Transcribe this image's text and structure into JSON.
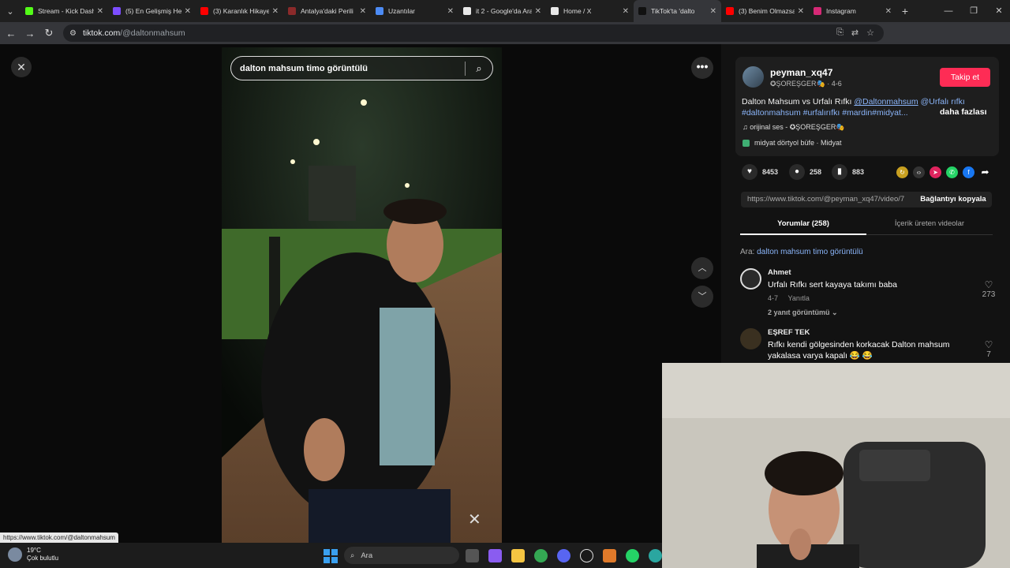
{
  "browser": {
    "tabs": [
      {
        "label": "Stream - Kick Dash",
        "color": "#53fc18"
      },
      {
        "label": "(5) En Gelişmiş Hes",
        "color": "#7c4dff"
      },
      {
        "label": "(3) Karanlık Hikaye",
        "color": "#ff0000"
      },
      {
        "label": "Antalya'daki Perili",
        "color": "#8b2a2a"
      },
      {
        "label": "Uzantılar",
        "color": "#4c8bf5"
      },
      {
        "label": "it 2 - Google'da Ara",
        "color": "#e8e8e8"
      },
      {
        "label": "Home / X",
        "color": "#e8e8e8"
      },
      {
        "label": "TikTok'ta 'dalto",
        "color": "#111111"
      },
      {
        "label": "(3) Benim Olmazsa",
        "color": "#ff0000"
      },
      {
        "label": "Instagram",
        "color": "#d62976"
      }
    ],
    "tab_close": "✕",
    "tab_menu": "⌄",
    "new_tab": "+",
    "url_host": "tiktok.com",
    "url_path": "/@daltonmahsum"
  },
  "page": {
    "close": "✕",
    "search_query": "dalton mahsum timo görüntülü",
    "more": "•••",
    "arrow_up": "︿",
    "arrow_down": "﹀",
    "capcut": "✕"
  },
  "author": {
    "username": "peyman_xq47",
    "nick_line": "✪ŞOREŞGER🎭 · 4-6",
    "follow": "Takip et",
    "desc_text": "Dalton Mahsum vs Urfalı Rıfkı ",
    "desc_mention1": "@Daltonmahsum",
    "desc_mention2": "@Urfalı rıfkı",
    "desc_tags": "#daltonmahsum #urfalırıfkı #mardin#midyat...",
    "more_label": "daha fazlası",
    "music": "♫  orijinal ses - ✪ŞOREŞGER🎭",
    "location": "midyat dörtyol büfe · Midyat"
  },
  "actions": {
    "likes": "8453",
    "comments": "258",
    "saves": "883"
  },
  "link": {
    "url": "https://www.tiktok.com/@peyman_xq47/video/7",
    "copy": "Bağlantıyı kopyala"
  },
  "panel_tabs": {
    "comments": "Yorumlar (258)",
    "creator": "İçerik üreten videolar"
  },
  "search_hint": {
    "prefix": "Ara: ",
    "query": "dalton mahsum timo görüntülü"
  },
  "comments": [
    {
      "name": "Ahmet",
      "text": "Urfalı Rıfkı sert kayaya takımı baba",
      "date": "4-7",
      "reply": "Yanıtla",
      "replies": "2 yanıt görüntümü ⌄",
      "likes": "273"
    },
    {
      "name": "EŞREF TEK",
      "text": "Rıfkı kendi gölgesinden korkacak Dalton mahsum yakalasa varya kapalı 😂 😂",
      "likes": "7"
    }
  ],
  "status_url": "https://www.tiktok.com/@daltonmahsum",
  "taskbar": {
    "temp": "19°C",
    "weather": "Çok bulutlu",
    "search": "Ara"
  }
}
